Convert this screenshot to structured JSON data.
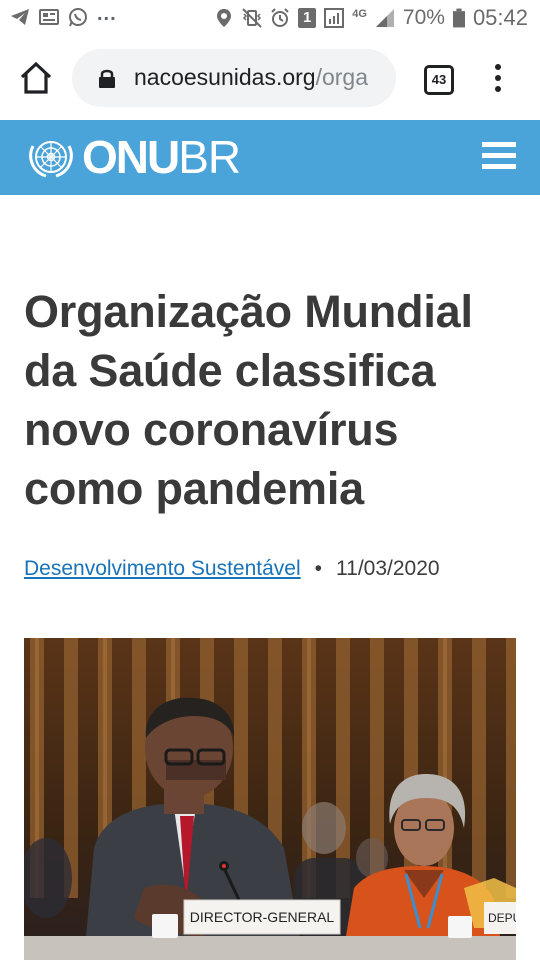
{
  "status_bar": {
    "battery": "70%",
    "time": "05:42",
    "network": "4G",
    "sim": "1",
    "more": "..."
  },
  "browser": {
    "url_domain": "nacoesunidas.org",
    "url_path": "/orga",
    "tab_count": "43"
  },
  "site": {
    "logo_main": "ONU",
    "logo_suffix": "BR",
    "header_color": "#4aa4d9"
  },
  "article": {
    "title": "Organização Mundial da Saúde classifica novo coronavírus como pandemia",
    "category": "Desenvolvimento Sustentável",
    "separator": "•",
    "date": "11/03/2020"
  },
  "photo": {
    "nameplate_left": "DIRECTOR-GENERAL",
    "nameplate_right": "DEPU"
  }
}
